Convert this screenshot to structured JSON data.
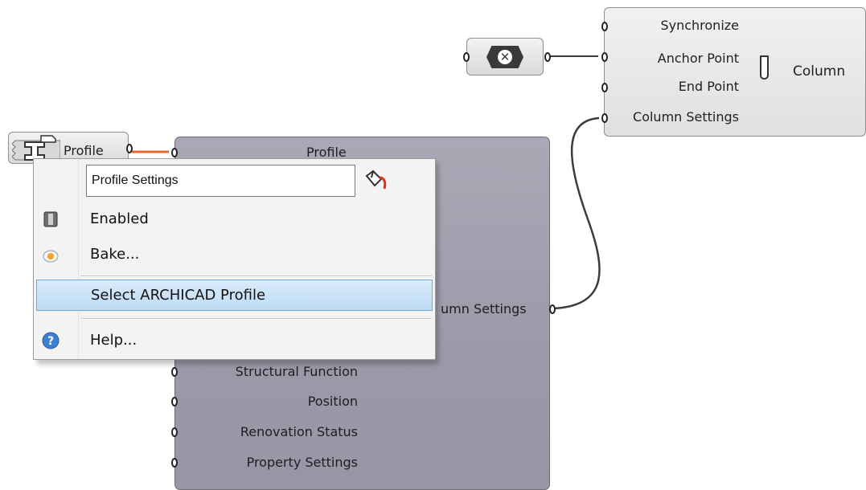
{
  "column_component": {
    "inputs": [
      "Synchronize",
      "Anchor Point",
      "End Point",
      "Column Settings"
    ],
    "name": "Column"
  },
  "profile_param": {
    "label": "Profile"
  },
  "profile_component": {
    "output_top": "Profile",
    "output_partial": "umn Settings",
    "inputs": [
      "Structural Function",
      "Position",
      "Renovation Status",
      "Property Settings"
    ]
  },
  "context_menu": {
    "name_field": "Profile Settings",
    "items": [
      {
        "label": "Enabled",
        "icon": "toggle-icon"
      },
      {
        "label": "Bake...",
        "icon": "bake-egg-icon"
      },
      {
        "label": "Select ARCHICAD Profile",
        "icon": ""
      },
      {
        "label": "Help...",
        "icon": "help-icon"
      }
    ]
  },
  "colors": {
    "wire": "#3c3c3c",
    "warning_wire": "#e8642a",
    "component_body": "#a2a1b0",
    "menu_highlight": "#c3def5"
  }
}
